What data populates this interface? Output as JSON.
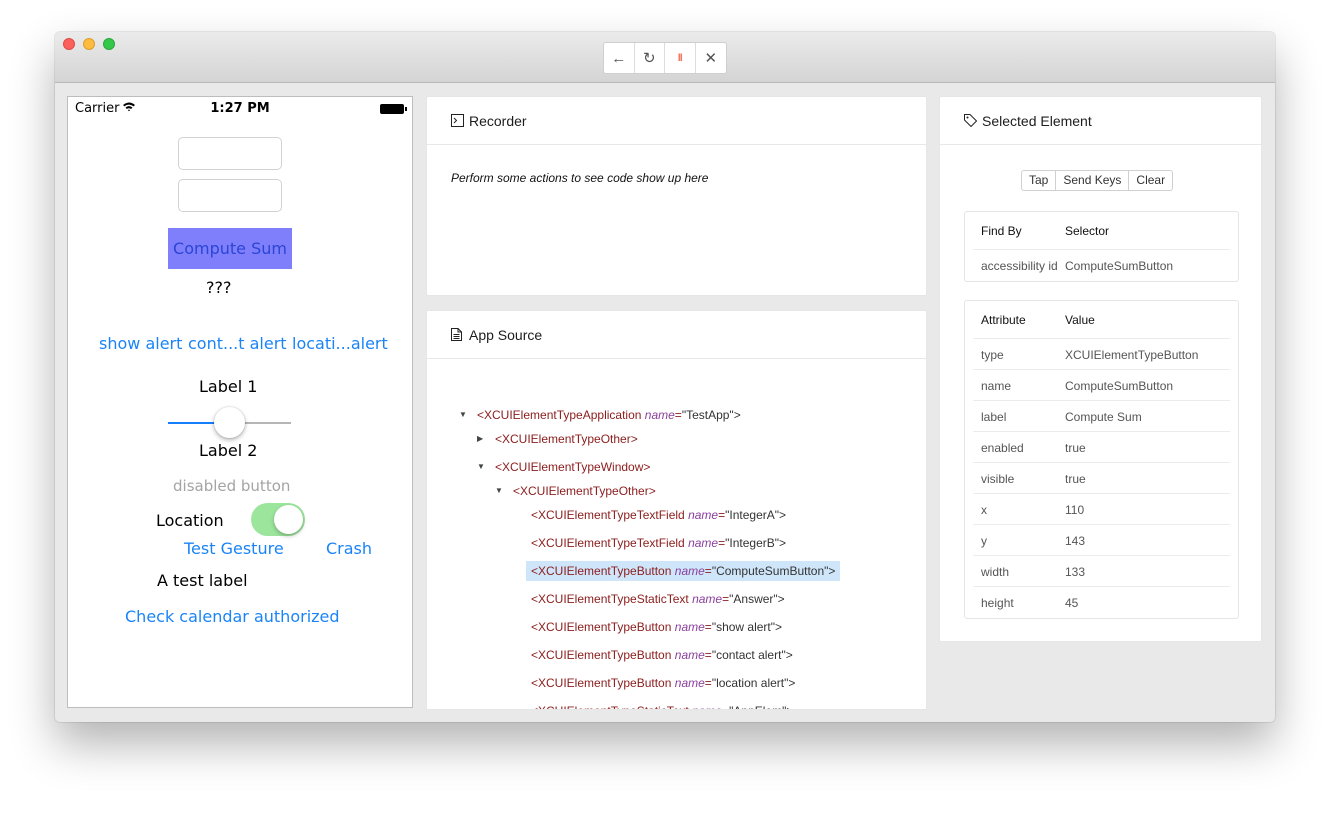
{
  "toolbar": {
    "back_icon": "←",
    "refresh_icon": "↻",
    "pause_icon": "II",
    "close_icon": "✕"
  },
  "device": {
    "carrier": "Carrier",
    "time": "1:27 PM",
    "compute_sum": "Compute Sum",
    "answer": "???",
    "show_alert": "show alert",
    "contact_alert": "cont...t alert",
    "location_alert": "locati...alert",
    "label1": "Label 1",
    "slider_value": 0.5,
    "label2": "Label 2",
    "disabled_button": "disabled button",
    "location_label": "Location",
    "location_toggle_on": true,
    "test_gesture": "Test Gesture",
    "crash": "Crash",
    "test_label": "A test label",
    "check_calendar": "Check calendar authorized"
  },
  "recorder": {
    "title": "Recorder",
    "message": "Perform some actions to see code show up here"
  },
  "source": {
    "title": "App Source",
    "nodes": [
      {
        "tag": "<XCUIElementTypeApplication",
        "attr": "name",
        "val": "\"TestApp\">",
        "caret": "down"
      },
      {
        "tag": "<XCUIElementTypeOther>",
        "attr": "",
        "val": "",
        "caret": "right"
      },
      {
        "tag": "<XCUIElementTypeWindow>",
        "attr": "",
        "val": "",
        "caret": "down"
      },
      {
        "tag": "<XCUIElementTypeOther>",
        "attr": "",
        "val": "",
        "caret": "down"
      },
      {
        "tag": "<XCUIElementTypeTextField",
        "attr": "name",
        "val": "\"IntegerA\">",
        "caret": ""
      },
      {
        "tag": "<XCUIElementTypeTextField",
        "attr": "name",
        "val": "\"IntegerB\">",
        "caret": ""
      },
      {
        "tag": "<XCUIElementTypeButton",
        "attr": "name",
        "val": "\"ComputeSumButton\">",
        "caret": "",
        "selected": true
      },
      {
        "tag": "<XCUIElementTypeStaticText",
        "attr": "name",
        "val": "\"Answer\">",
        "caret": ""
      },
      {
        "tag": "<XCUIElementTypeButton",
        "attr": "name",
        "val": "\"show alert\">",
        "caret": ""
      },
      {
        "tag": "<XCUIElementTypeButton",
        "attr": "name",
        "val": "\"contact alert\">",
        "caret": ""
      },
      {
        "tag": "<XCUIElementTypeButton",
        "attr": "name",
        "val": "\"location alert\">",
        "caret": ""
      },
      {
        "tag": "<XCUIElementTypeStaticText",
        "attr": "name",
        "val": "\"AppElem\">",
        "caret": ""
      }
    ]
  },
  "selected": {
    "title": "Selected Element",
    "actions": [
      "Tap",
      "Send Keys",
      "Clear"
    ],
    "find_headers": [
      "Find By",
      "Selector"
    ],
    "find_rows": [
      [
        "accessibility id",
        "ComputeSumButton"
      ]
    ],
    "attr_headers": [
      "Attribute",
      "Value"
    ],
    "attr_rows": [
      [
        "type",
        "XCUIElementTypeButton"
      ],
      [
        "name",
        "ComputeSumButton"
      ],
      [
        "label",
        "Compute Sum"
      ],
      [
        "enabled",
        "true"
      ],
      [
        "visible",
        "true"
      ],
      [
        "x",
        "110"
      ],
      [
        "y",
        "143"
      ],
      [
        "width",
        "133"
      ],
      [
        "height",
        "45"
      ]
    ]
  }
}
